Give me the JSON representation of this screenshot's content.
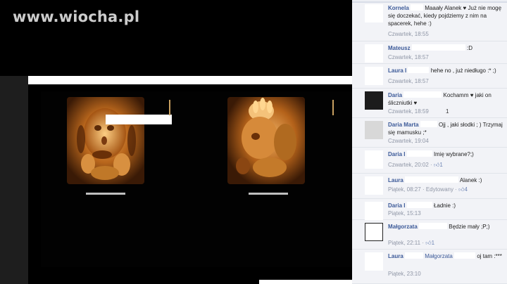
{
  "watermark": "www.wiocha.pl",
  "comments": [
    {
      "author": "Kornela",
      "text": "Maaały Alanek ♥ Już nie mogę się doczekać, kiedy pojdziemy z nim na spacerek, hehe :)",
      "time": "Czwartek, 18:55"
    },
    {
      "author": "Mateusz",
      "text": ":D",
      "time": "Czwartek, 18:57"
    },
    {
      "author": "Laura I",
      "text": "hehe no , już niedługo :* ;)",
      "time": "Czwartek, 18:57"
    },
    {
      "author": "Daria",
      "text": "Kochamm ♥ jaki on śliczniutki ♥",
      "time": "Czwartek, 18:59",
      "extra": "1"
    },
    {
      "author": "Daria Marta",
      "text": "Ojj , jaki słodki ; ) Trzymaj się mamusku ;*",
      "time": "Czwartek, 19:04"
    },
    {
      "author": "Daria I",
      "text": "Imię wybrane?;)",
      "time": "Czwartek, 20:02",
      "likes": "1"
    },
    {
      "author": "Laura",
      "text": "Alanek :)",
      "time": "Piątek, 08:27",
      "edited": "Edytowany",
      "likes": "4"
    },
    {
      "author": "Daria I",
      "text": "Ładnie :)",
      "time": "Piątek, 15:13"
    },
    {
      "author": "Małgorzata",
      "text": "Będzie mały ;P;)",
      "time": "Piątek, 22:11",
      "likes": "1"
    },
    {
      "author": "Laura",
      "mention": "Małgorzata",
      "text": "oj tam :***",
      "time": "Piątek, 23:10"
    }
  ]
}
